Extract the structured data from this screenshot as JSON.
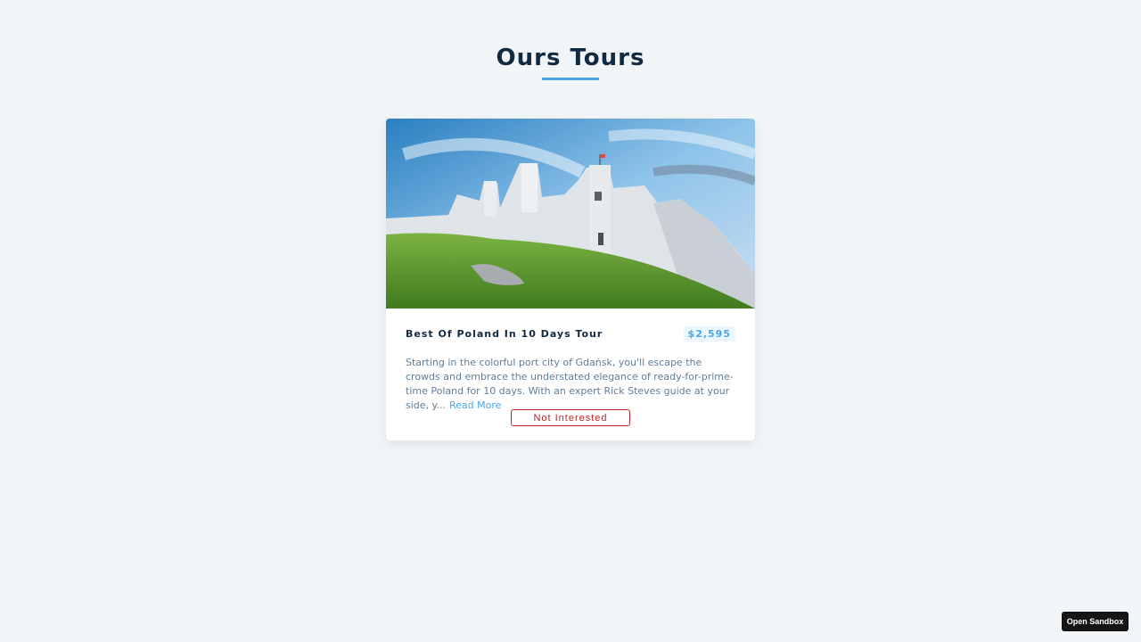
{
  "page": {
    "title": "Ours Tours"
  },
  "tour": {
    "image_alt": "castle ruins on a green hill",
    "name": "Best Of Poland In 10 Days Tour",
    "price": "$2,595",
    "info": "Starting in the colorful port city of Gdańsk, you'll escape the crowds and embrace the understated elegance of ready-for-prime-time Poland for 10 days. With an expert Rick Steves guide at your side, y...",
    "read_more_label": "Read More",
    "not_interested_label": "Not Interested"
  },
  "sandbox": {
    "label": "Open Sandbox"
  },
  "colors": {
    "background": "#f1f5f8",
    "title": "#102a42",
    "accent": "#49a6e9",
    "danger": "#bb2525"
  }
}
